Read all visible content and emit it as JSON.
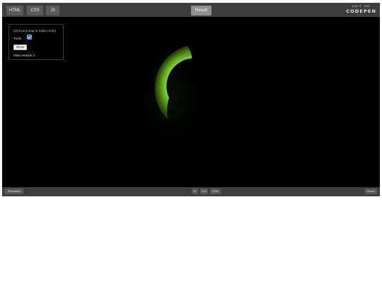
{
  "topbar": {
    "tabs": [
      {
        "label": "HTML"
      },
      {
        "label": "CSS"
      },
      {
        "label": "JS"
      }
    ],
    "result_label": "Result",
    "logo_small": "EDIT ON",
    "logo_big": "CODEPEN"
  },
  "panel": {
    "hint": "Click and drag to make more!",
    "trails_label": "Trails",
    "trails_checked": true,
    "clear_label": "Clear",
    "version_link": "View Version 2"
  },
  "bottombar": {
    "resources_label": "Resources",
    "zoom_options": [
      "1×",
      "0.5×",
      "0.25×"
    ],
    "rerun_label": "Rerun"
  },
  "colors": {
    "bar": "#3d3d3e",
    "button": "#5a5a5c",
    "active_tab": "#8f8f91",
    "trail_bright": "#9be03a",
    "trail_dark": "#0d2a06"
  }
}
